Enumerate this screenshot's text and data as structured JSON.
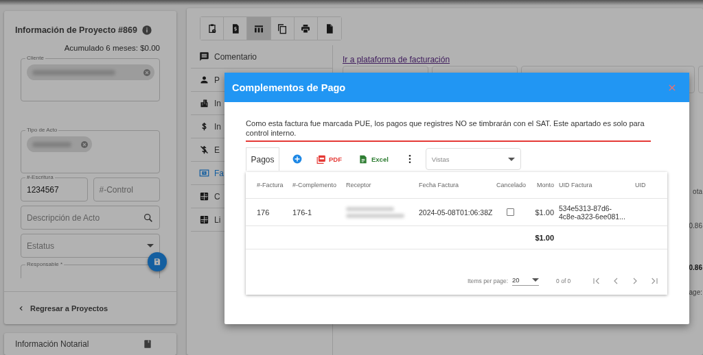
{
  "project_panel": {
    "title": "Información de Proyecto #869",
    "accumulated": "Acumulado 6 meses: $0.00",
    "fields": [
      {
        "kind": "chips",
        "label": "Cliente",
        "chips": [
          {
            "blurred": true,
            "wide": true
          }
        ]
      },
      {
        "kind": "chips",
        "label": "Tipo de Acto",
        "chips": [
          {
            "blurred": true,
            "wide": false
          }
        ]
      },
      {
        "kind": "pair",
        "items": [
          {
            "label": "#-Escritura",
            "value": "1234567"
          },
          {
            "placeholder": "#-Control"
          }
        ]
      },
      {
        "kind": "search",
        "placeholder": "Descripción de Acto"
      },
      {
        "kind": "select",
        "placeholder": "Estatus"
      },
      {
        "kind": "cut",
        "label": "Responsable *"
      }
    ],
    "back_link": "Regresar a Proyectos"
  },
  "notarial_panel": {
    "title": "Información Notarial"
  },
  "toolbar_buttons": [
    {
      "selected": false
    },
    {
      "selected": false
    },
    {
      "selected": true
    },
    {
      "selected": false
    },
    {
      "selected": false
    },
    {
      "selected": false
    }
  ],
  "side_menu": [
    {
      "label": "Comentario",
      "selected": false
    },
    {
      "label": "P",
      "selected": false
    },
    {
      "label": "In",
      "selected": false
    },
    {
      "label": "In",
      "selected": false
    },
    {
      "label": "E",
      "selected": false
    },
    {
      "label": "Fa",
      "selected": true
    },
    {
      "label": "C",
      "selected": false
    },
    {
      "label": "Li",
      "selected": false
    }
  ],
  "content": {
    "link": "Ir a plataforma de facturación",
    "edge_texts": [
      {
        "text": "ota",
        "bold": false
      },
      {
        "text": "0.86",
        "bold": false
      },
      {
        "text": "0.86",
        "bold": true
      },
      {
        "text": "age:",
        "bold": false
      }
    ]
  },
  "dialog": {
    "title": "Complementos de Pago",
    "notice": "Como esta factura fue marcada PUE, los pagos que registres NO se timbrarán con el SAT. Este apartado es solo para control interno.",
    "tab": "Pagos",
    "pdf_button": "PDF",
    "excel_button": "Excel",
    "views_select": {
      "placeholder": "Vistas"
    },
    "table": {
      "columns": [
        "#-Factura",
        "#-Complemento",
        "Receptor",
        "Fecha Factura",
        "Cancelado",
        "Monto",
        "UID Factura",
        "UID"
      ],
      "rows": [
        {
          "factura": "176",
          "complemento": "176-1",
          "receptor_blurred": true,
          "fecha": "2024-05-08T01:06:38Z",
          "cancelado": false,
          "monto": "$1.00",
          "uid_factura": "534e5313-87d6-4c8e-a323-6ee081..."
        }
      ],
      "total": "$1.00"
    },
    "paginator": {
      "label": "Items per page:",
      "page_size": "20",
      "range": "0 of 0"
    }
  }
}
